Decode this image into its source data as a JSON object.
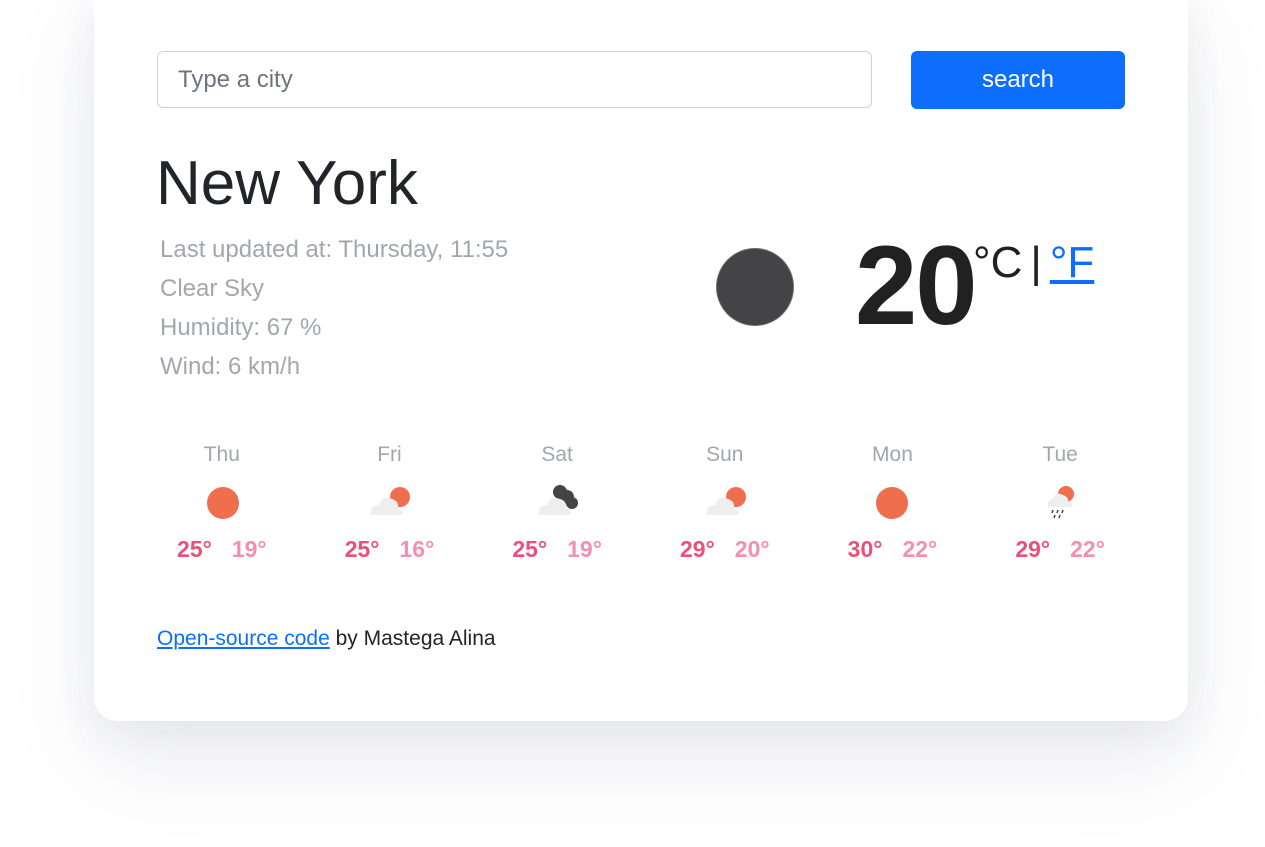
{
  "search": {
    "placeholder": "Type a city",
    "value": "",
    "button_label": "search"
  },
  "current": {
    "city": "New York",
    "last_updated": "Last updated at: Thursday, 11:55",
    "description": "Clear Sky",
    "humidity": "Humidity: 67 %",
    "wind": "Wind: 6 km/h",
    "icon": "moon-icon",
    "temperature": "20",
    "unit_celsius": "°C",
    "unit_separator": "|",
    "unit_fahrenheit": "°F"
  },
  "forecast": [
    {
      "day": "Thu",
      "icon": "sun-icon",
      "max": "25°",
      "min": "19°"
    },
    {
      "day": "Fri",
      "icon": "cloud-sun-icon",
      "max": "25°",
      "min": "16°"
    },
    {
      "day": "Sat",
      "icon": "cloud-moon-icon",
      "max": "25°",
      "min": "19°"
    },
    {
      "day": "Sun",
      "icon": "cloud-sun-icon",
      "max": "29°",
      "min": "20°"
    },
    {
      "day": "Mon",
      "icon": "sun-icon",
      "max": "30°",
      "min": "22°"
    },
    {
      "day": "Tue",
      "icon": "rain-sun-icon",
      "max": "29°",
      "min": "22°"
    }
  ],
  "footer": {
    "link_text": "Open-source code",
    "text": "by Mastega Alina"
  },
  "colors": {
    "accent": "#0d6efd",
    "temp_max": "#e8517a",
    "temp_min": "#f48fb1",
    "sun": "#ee6e4e",
    "cloud": "#eeeeee",
    "moon": "#444446"
  }
}
